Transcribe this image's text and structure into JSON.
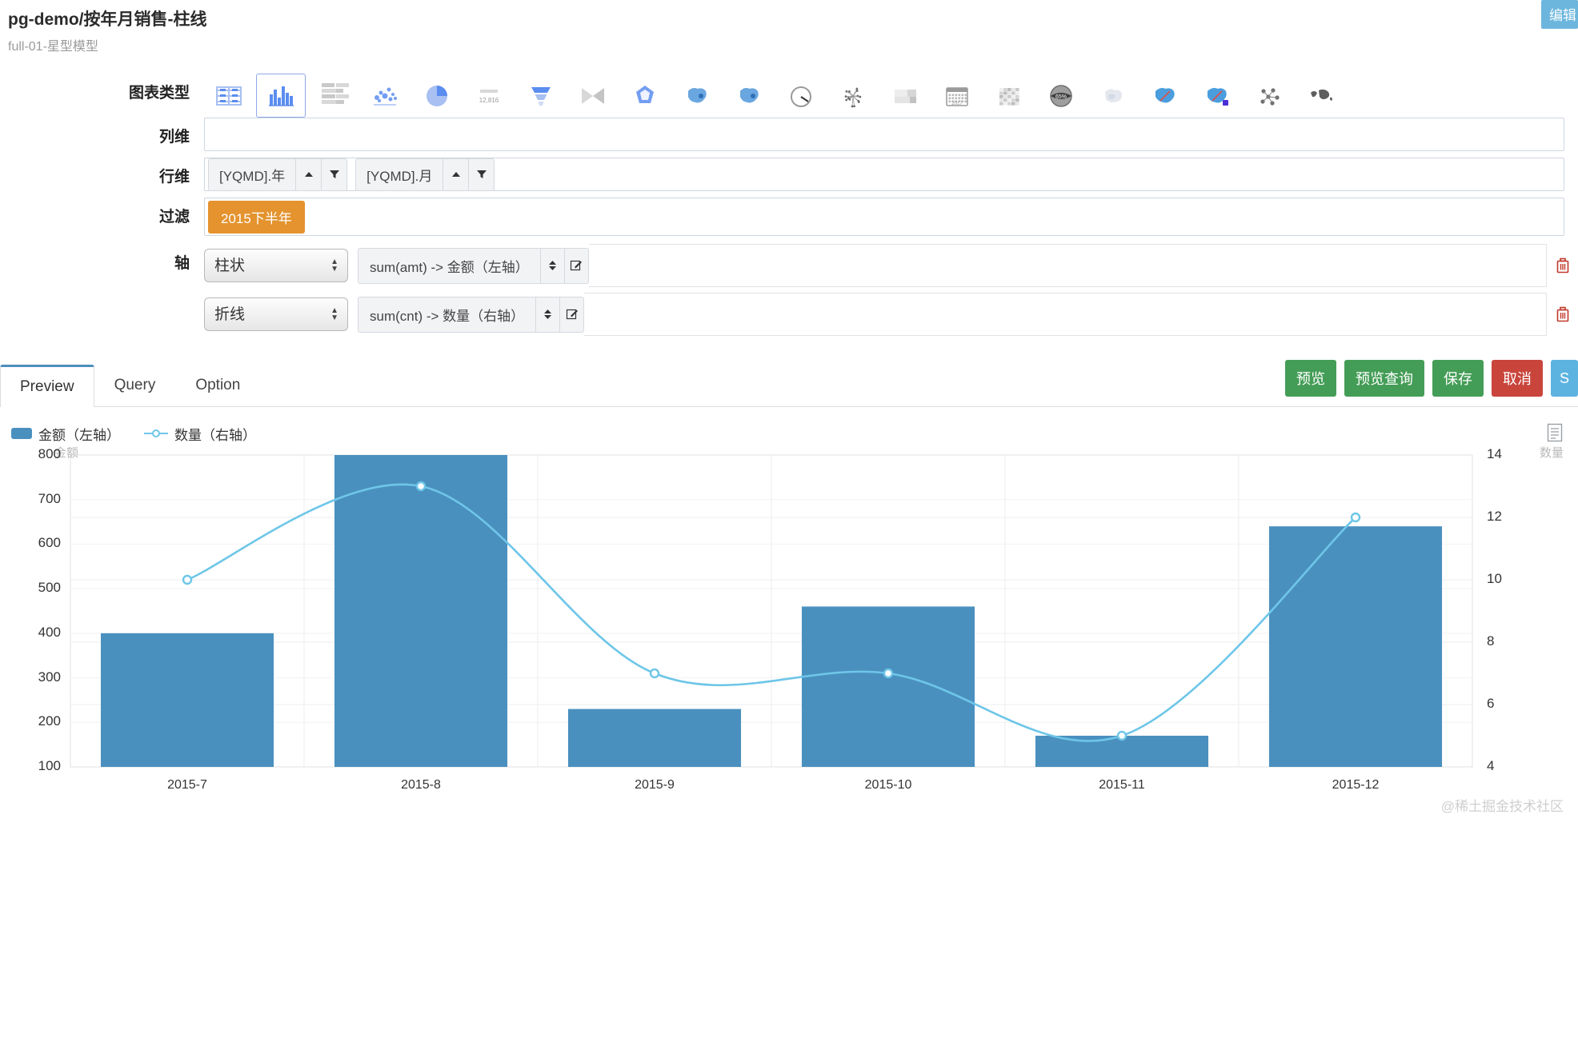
{
  "header": {
    "title": "pg-demo/按年月销售-柱线",
    "subtitle": "full-01-星型模型",
    "edit_button": "编辑"
  },
  "form": {
    "chart_type_label": "图表类型",
    "chart_types": [
      {
        "name": "table-icon",
        "selected": false
      },
      {
        "name": "column-chart-icon",
        "selected": true
      },
      {
        "name": "bar-chart-icon",
        "selected": false
      },
      {
        "name": "scatter-chart-icon",
        "selected": false
      },
      {
        "name": "pie-chart-icon",
        "selected": false
      },
      {
        "name": "number-card-icon",
        "selected": false,
        "text": "12,816"
      },
      {
        "name": "funnel-chart-icon",
        "selected": false
      },
      {
        "name": "sankey-chart-icon",
        "selected": false
      },
      {
        "name": "radar-chart-icon",
        "selected": false
      },
      {
        "name": "map-chart-icon",
        "selected": false
      },
      {
        "name": "china-map-icon",
        "selected": false
      },
      {
        "name": "gauge-chart-icon",
        "selected": false
      },
      {
        "name": "graph-network-icon",
        "selected": false
      },
      {
        "name": "treemap-chart-icon",
        "selected": false
      },
      {
        "name": "calendar-chart-icon",
        "selected": false,
        "text": "2017"
      },
      {
        "name": "heatmap-chart-icon",
        "selected": false
      },
      {
        "name": "percent-gauge-icon",
        "selected": false,
        "text": "65%"
      },
      {
        "name": "region-map-icon",
        "selected": false
      },
      {
        "name": "china-migrate-map-icon",
        "selected": false
      },
      {
        "name": "baidu-map-icon",
        "selected": false
      },
      {
        "name": "relation-graph-icon",
        "selected": false
      },
      {
        "name": "world-map-icon",
        "selected": false
      }
    ],
    "col_dim_label": "列维",
    "col_dims": [],
    "row_dim_label": "行维",
    "row_dims": [
      "[YQMD].年",
      "[YQMD].月"
    ],
    "filter_label": "过滤",
    "filters": [
      "2015下半年"
    ],
    "axis_label": "轴",
    "axes": [
      {
        "type": "柱状",
        "measure": "sum(amt) -> 金额（左轴）"
      },
      {
        "type": "折线",
        "measure": "sum(cnt) -> 数量（右轴）"
      }
    ],
    "axis_type_options": [
      "柱状",
      "折线"
    ]
  },
  "tabs": [
    {
      "label": "Preview",
      "active": true
    },
    {
      "label": "Query",
      "active": false
    },
    {
      "label": "Option",
      "active": false
    }
  ],
  "actions": [
    {
      "label": "预览",
      "color": "green"
    },
    {
      "label": "预览查询",
      "color": "green"
    },
    {
      "label": "保存",
      "color": "green"
    },
    {
      "label": "取消",
      "color": "red"
    },
    {
      "label": "S",
      "color": "blue"
    }
  ],
  "watermark": "@稀土掘金技术社区",
  "chart_data": {
    "type": "bar",
    "title": "",
    "categories": [
      "2015-7",
      "2015-8",
      "2015-9",
      "2015-10",
      "2015-11",
      "2015-12"
    ],
    "series": [
      {
        "name": "金额（左轴）",
        "type": "bar",
        "axis": "left",
        "color": "#4a90bf",
        "values": [
          400,
          800,
          230,
          460,
          170,
          640
        ]
      },
      {
        "name": "数量（右轴）",
        "type": "line",
        "axis": "right",
        "color": "#6ec6e8",
        "values": [
          10,
          13,
          7,
          7,
          5,
          12
        ]
      }
    ],
    "left_axis": {
      "name": "金额",
      "ticks": [
        100,
        200,
        300,
        400,
        500,
        600,
        700,
        800
      ],
      "ylim": [
        100,
        800
      ]
    },
    "right_axis": {
      "name": "数量",
      "ticks": [
        4,
        6,
        8,
        10,
        12,
        14
      ],
      "ylim": [
        4,
        14
      ]
    },
    "xlabel": "",
    "grid": true,
    "legend_position": "top-left"
  }
}
